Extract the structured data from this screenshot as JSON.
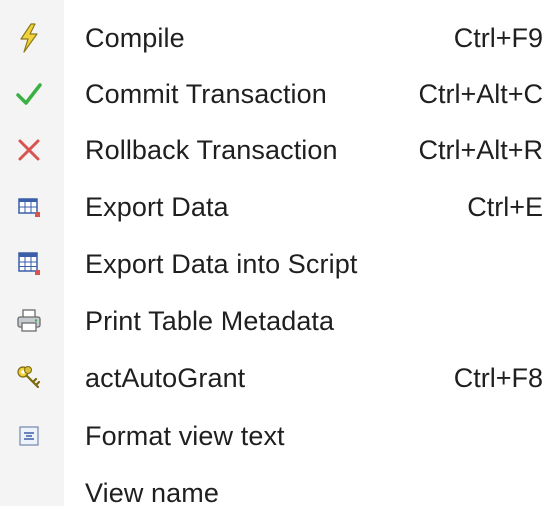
{
  "menu": {
    "items": [
      {
        "label": "Compile",
        "shortcut": "Ctrl+F9",
        "icon": "lightning-icon"
      },
      {
        "label": "Commit Transaction",
        "shortcut": "Ctrl+Alt+C",
        "icon": "checkmark-icon"
      },
      {
        "label": "Rollback Transaction",
        "shortcut": "Ctrl+Alt+R",
        "icon": "red-x-icon"
      },
      {
        "label": "Export Data",
        "shortcut": "Ctrl+E",
        "icon": "table-export-icon"
      },
      {
        "label": "Export Data into Script",
        "shortcut": "",
        "icon": "table-script-export-icon"
      },
      {
        "label": "Print Table Metadata",
        "shortcut": "",
        "icon": "printer-icon"
      },
      {
        "label": "actAutoGrant",
        "shortcut": "Ctrl+F8",
        "icon": "keys-icon"
      },
      {
        "label": "Format view text",
        "shortcut": "",
        "icon": "format-text-icon"
      },
      {
        "label": "View name",
        "shortcut": "",
        "icon": ""
      }
    ]
  },
  "colors": {
    "text": "#1f1f1f",
    "gutter": "#f4f4f4",
    "check_green": "#3cb043",
    "rollback_red": "#d9534f",
    "lightning_yellow": "#f2d23c"
  }
}
